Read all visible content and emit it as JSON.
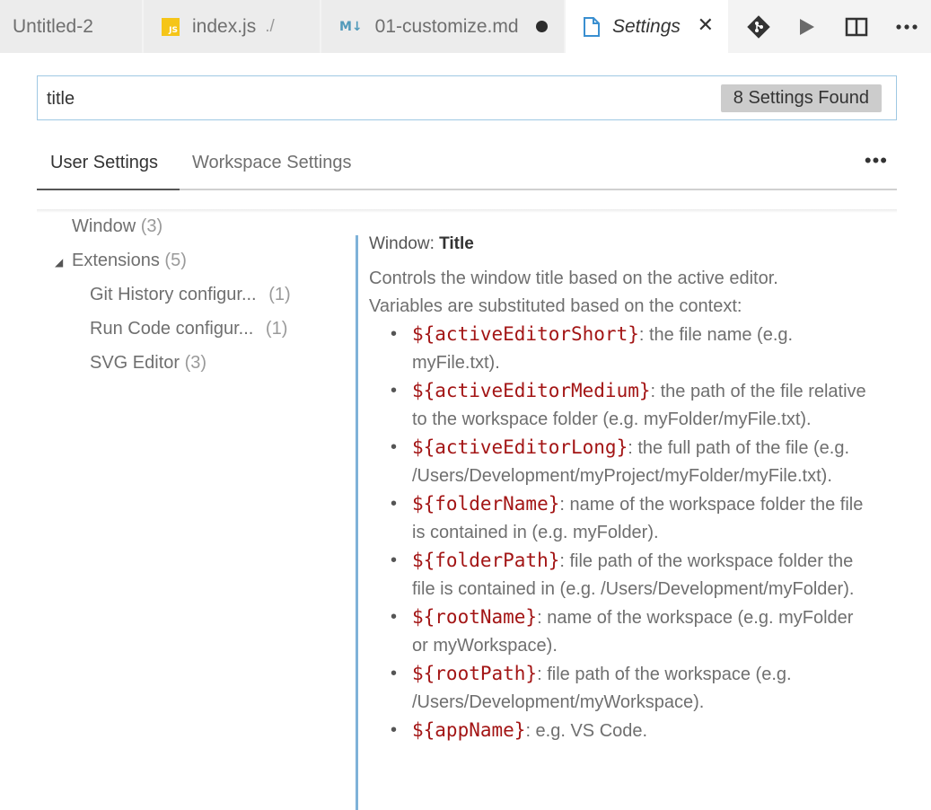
{
  "tabs": [
    {
      "label": "Untitled-2"
    },
    {
      "label": "index.js",
      "desc": "./",
      "icon": "JS"
    },
    {
      "label": "01-customize.md",
      "icon": "M↓"
    },
    {
      "label": "Settings"
    }
  ],
  "close_glyph": "✕",
  "search": {
    "value": "title",
    "badge": "8 Settings Found"
  },
  "scopes": {
    "user": "User Settings",
    "workspace": "Workspace Settings",
    "more": "•••"
  },
  "toc": {
    "window": {
      "label": "Window",
      "count": "(3)"
    },
    "extensions": {
      "label": "Extensions",
      "count": "(5)"
    },
    "git_history": {
      "label": "Git History configur...",
      "count": "(1)"
    },
    "run_code": {
      "label": "Run Code configur...",
      "count": "(1)"
    },
    "svg_editor": {
      "label": "SVG Editor",
      "count": "(3)"
    }
  },
  "setting": {
    "category": "Window:",
    "name": "Title",
    "desc1": "Controls the window title based on the active editor.",
    "desc2": "Variables are substituted based on the context:",
    "variables": [
      {
        "var": "${activeEditorShort}",
        "desc": ": the file name (e.g. myFile.txt)."
      },
      {
        "var": "${activeEditorMedium}",
        "desc": ": the path of the file relative to the workspace folder (e.g. myFolder/myFile.txt)."
      },
      {
        "var": "${activeEditorLong}",
        "desc": ": the full path of the file (e.g. /Users/Development/myProject/myFolder/myFile.txt)."
      },
      {
        "var": "${folderName}",
        "desc": ": name of the workspace folder the file is contained in (e.g. myFolder)."
      },
      {
        "var": "${folderPath}",
        "desc": ": file path of the workspace folder the file is contained in (e.g. /Users/Development/myFolder)."
      },
      {
        "var": "${rootName}",
        "desc": ": name of the workspace (e.g. myFolder or myWorkspace)."
      },
      {
        "var": "${rootPath}",
        "desc": ": file path of the workspace (e.g. /Users/Development/myWorkspace)."
      },
      {
        "var": "${appName}",
        "desc": ": e.g. VS Code."
      }
    ]
  },
  "colors": {
    "accent": "#7fb2d8",
    "variable": "#a31515",
    "search_border": "#9fc8e3"
  }
}
